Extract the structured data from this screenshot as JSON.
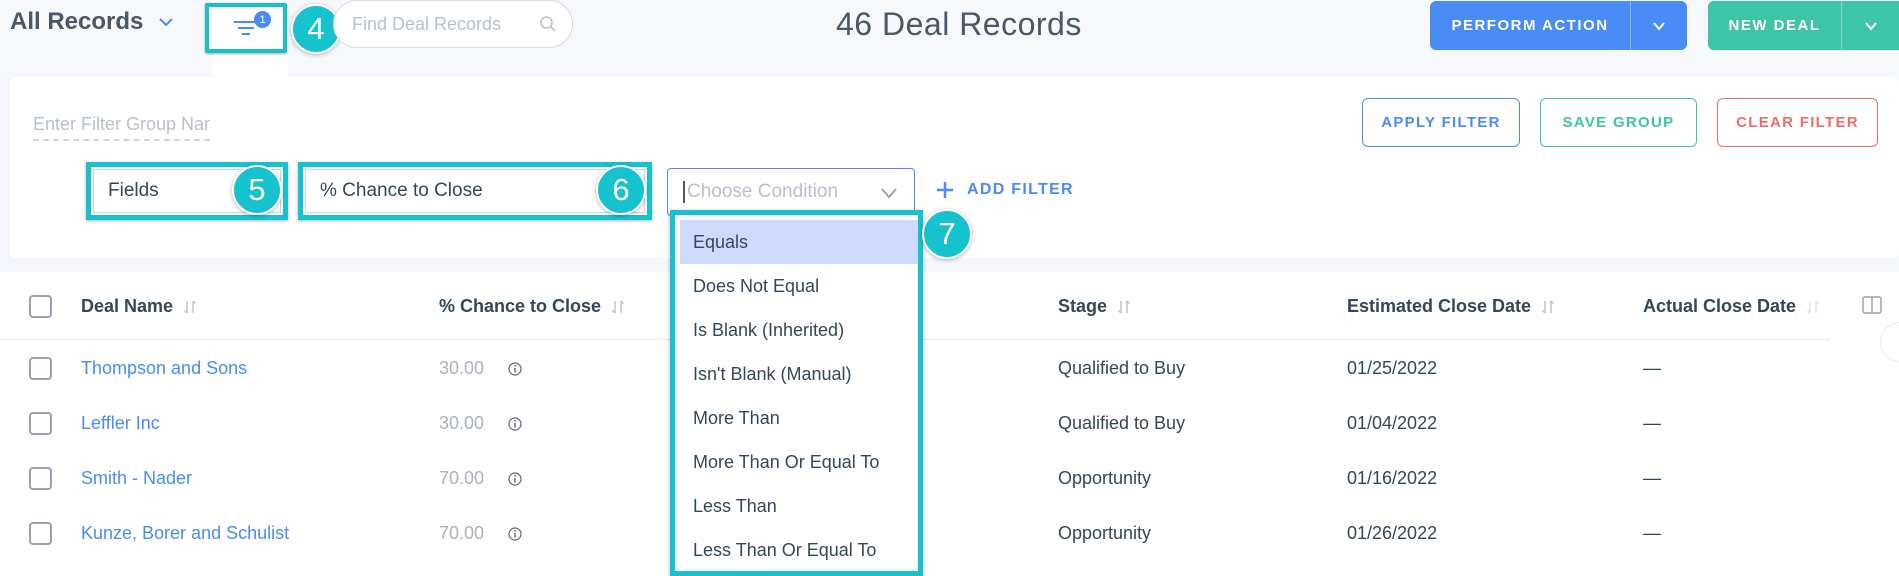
{
  "header": {
    "view_label": "All Records",
    "filter_count": "1",
    "search_placeholder": "Find Deal Records",
    "title": "46 Deal Records",
    "perform_action_label": "PERFORM ACTION",
    "new_deal_label": "NEW DEAL"
  },
  "callouts": [
    "4",
    "5",
    "6",
    "7"
  ],
  "filter_panel": {
    "group_name_placeholder": "Enter Filter Group Name",
    "apply_label": "APPLY FILTER",
    "save_label": "SAVE GROUP",
    "clear_label": "CLEAR FILTER",
    "fields_value": "Fields",
    "field_value": "% Chance to Close",
    "condition_placeholder": "Choose Condition",
    "add_filter_label": "ADD FILTER"
  },
  "condition_options": [
    "Equals",
    "Does Not Equal",
    "Is Blank (Inherited)",
    "Isn't Blank (Manual)",
    "More Than",
    "More Than Or Equal To",
    "Less Than",
    "Less Than Or Equal To"
  ],
  "table": {
    "columns": [
      "Deal Name",
      "% Chance to Close",
      "Stage",
      "Estimated Close Date",
      "Actual Close Date"
    ],
    "rows": [
      {
        "name": "Thompson and Sons",
        "chance": "30.00",
        "stage": "Qualified to Buy",
        "est_close": "01/25/2022",
        "actual_close": "—"
      },
      {
        "name": "Leffler Inc",
        "chance": "30.00",
        "stage": "Qualified to Buy",
        "est_close": "01/04/2022",
        "actual_close": "—"
      },
      {
        "name": "Smith - Nader",
        "chance": "70.00",
        "stage": "Opportunity",
        "est_close": "01/16/2022",
        "actual_close": "—"
      },
      {
        "name": "Kunze, Borer and Schulist",
        "chance": "70.00",
        "stage": "Opportunity",
        "est_close": "01/26/2022",
        "actual_close": "—"
      }
    ]
  },
  "colors": {
    "highlight": "#17c2cf",
    "primary": "#4a8cf6",
    "success": "#3ec4a6",
    "danger": "#f26b6b"
  }
}
